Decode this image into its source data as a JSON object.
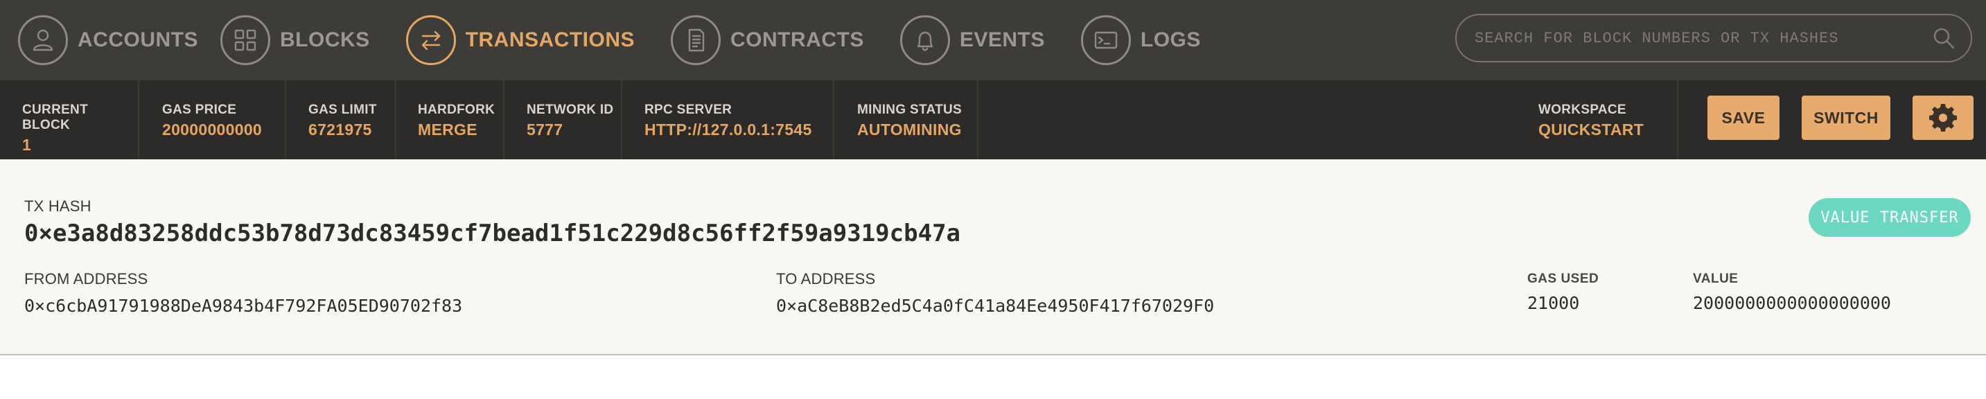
{
  "nav": {
    "items": [
      {
        "label": "ACCOUNTS",
        "icon": "user-icon"
      },
      {
        "label": "BLOCKS",
        "icon": "grid-icon"
      },
      {
        "label": "TRANSACTIONS",
        "icon": "arrows-icon"
      },
      {
        "label": "CONTRACTS",
        "icon": "document-icon"
      },
      {
        "label": "EVENTS",
        "icon": "bell-icon"
      },
      {
        "label": "LOGS",
        "icon": "terminal-icon"
      }
    ],
    "active": "TRANSACTIONS",
    "search": {
      "placeholder": "SEARCH FOR BLOCK NUMBERS OR TX HASHES"
    }
  },
  "status": {
    "current_block": {
      "label": "CURRENT BLOCK",
      "value": "1"
    },
    "gas_price": {
      "label": "GAS PRICE",
      "value": "20000000000"
    },
    "gas_limit": {
      "label": "GAS LIMIT",
      "value": "6721975"
    },
    "hardfork": {
      "label": "HARDFORK",
      "value": "MERGE"
    },
    "network_id": {
      "label": "NETWORK ID",
      "value": "5777"
    },
    "rpc_server": {
      "label": "RPC SERVER",
      "value": "HTTP://127.0.0.1:7545"
    },
    "mining_status": {
      "label": "MINING STATUS",
      "value": "AUTOMINING"
    },
    "workspace": {
      "label": "WORKSPACE",
      "value": "QUICKSTART"
    },
    "save_label": "SAVE",
    "switch_label": "SWITCH"
  },
  "tx": {
    "hash_label": "TX HASH",
    "hash": "0×e3a8d83258ddc53b78d73dc83459cf7bead1f51c229d8c56ff2f59a9319cb47a",
    "type_badge": "VALUE TRANSFER",
    "from_label": "FROM ADDRESS",
    "from": "0×c6cbA91791988DeA9843b4F792FA05ED90702f83",
    "to_label": "TO ADDRESS",
    "to": "0×aC8eB8B2ed5C4a0fC41a84Ee4950F417f67029F0",
    "gas_used_label": "GAS USED",
    "gas_used": "21000",
    "value_label": "VALUE",
    "value": "2000000000000000000"
  },
  "colors": {
    "nav_bg": "#3e3c39",
    "status_bg": "#2d2b29",
    "accent": "#e4a663",
    "badge": "#6dd8c2",
    "panel_bg": "#f8f7f4"
  }
}
